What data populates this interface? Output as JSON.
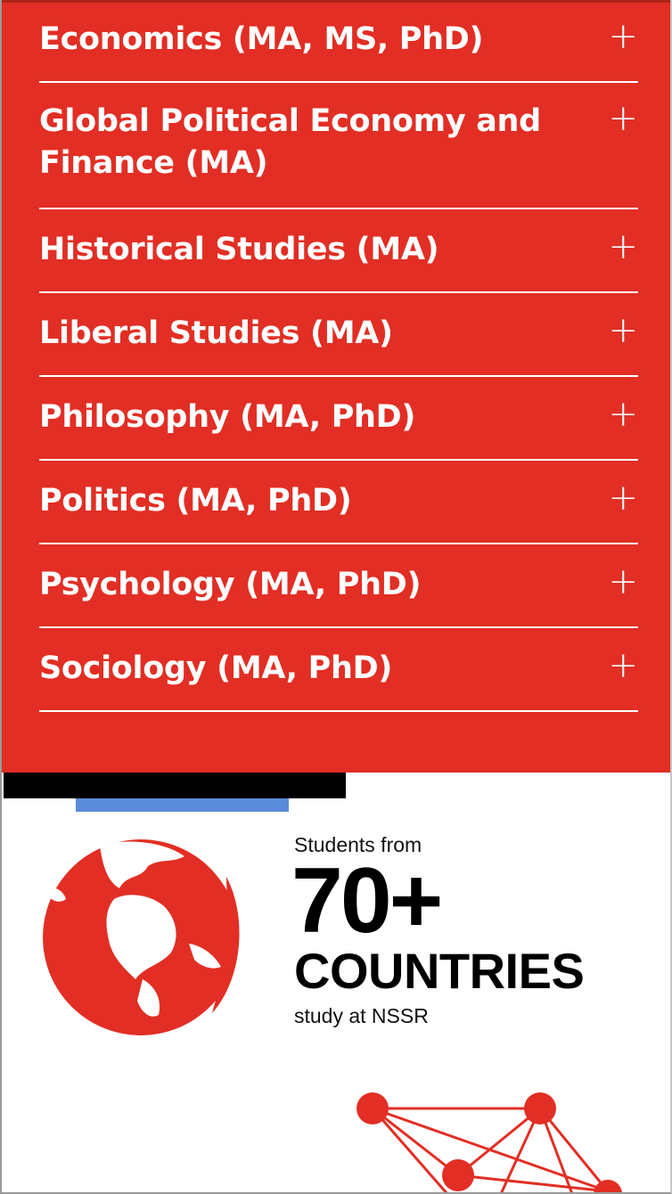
{
  "programs": {
    "items": [
      {
        "label": "Economics (MA, MS, PhD)",
        "toggle": "+"
      },
      {
        "label": "Global Political Economy and Finance (MA)",
        "toggle": "+"
      },
      {
        "label": "Historical Studies (MA)",
        "toggle": "+"
      },
      {
        "label": "Liberal Studies (MA)",
        "toggle": "+"
      },
      {
        "label": "Philosophy (MA, PhD)",
        "toggle": "+"
      },
      {
        "label": "Politics (MA, PhD)",
        "toggle": "+"
      },
      {
        "label": "Psychology (MA, PhD)",
        "toggle": "+"
      },
      {
        "label": "Sociology (MA, PhD)",
        "toggle": "+"
      }
    ]
  },
  "stats": {
    "pre_text": "Students from",
    "big_number": "70+",
    "big_word": "COUNTRIES",
    "post_text": "study at NSSR",
    "globe_icon": "globe-icon",
    "network_icon": "network-graphic"
  },
  "colors": {
    "accent_red": "#e22e24",
    "accent_blue": "#5a8bdb",
    "text_white": "#ffffff",
    "text_black": "#000000"
  }
}
